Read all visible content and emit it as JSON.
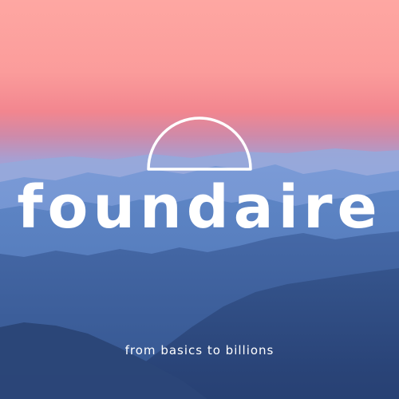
{
  "brand": {
    "name": "foundaire",
    "tagline": "from basics to billions"
  },
  "icons": {
    "logo": "half-sun-arc-icon"
  },
  "colors": {
    "sky_top": "#fda6a3",
    "sky_mid": "#f4878d",
    "haze": "#a69fd2",
    "mountain_far": "#8ea3d9",
    "mountain_mid": "#6c8fcc",
    "mountain_near": "#4a6fae",
    "mountain_front": "#2f4d86",
    "text": "#ffffff"
  }
}
